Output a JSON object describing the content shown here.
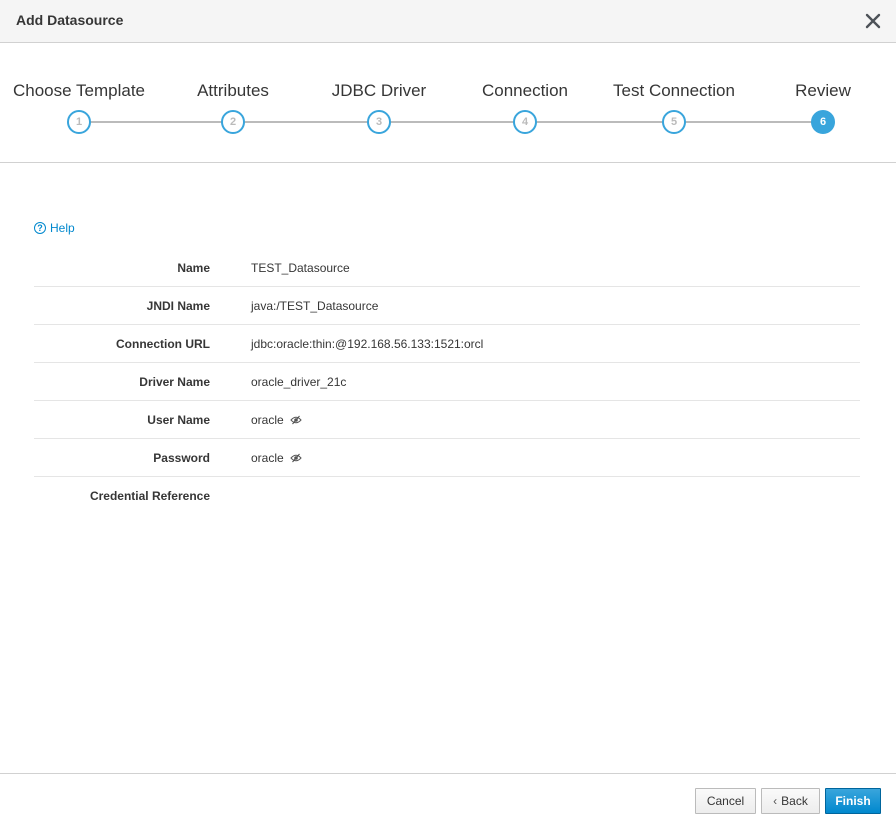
{
  "modal": {
    "title": "Add Datasource"
  },
  "wizard": {
    "steps": [
      {
        "label": "Choose Template",
        "number": "1"
      },
      {
        "label": "Attributes",
        "number": "2"
      },
      {
        "label": "JDBC Driver",
        "number": "3"
      },
      {
        "label": "Connection",
        "number": "4"
      },
      {
        "label": "Test Connection",
        "number": "5"
      },
      {
        "label": "Review",
        "number": "6"
      }
    ],
    "active_step": 6
  },
  "help": {
    "label": "Help",
    "icon": "question-circle-icon"
  },
  "review": {
    "rows": [
      {
        "label": "Name",
        "value": "TEST_Datasource"
      },
      {
        "label": "JNDI Name",
        "value": "java:/TEST_Datasource"
      },
      {
        "label": "Connection URL",
        "value": "jdbc:oracle:thin:@192.168.56.133:1521:orcl"
      },
      {
        "label": "Driver Name",
        "value": "oracle_driver_21c"
      },
      {
        "label": "User Name",
        "value": "oracle"
      },
      {
        "label": "Password",
        "value": "oracle"
      },
      {
        "label": "Credential Reference",
        "value": ""
      }
    ]
  },
  "footer": {
    "cancel_label": "Cancel",
    "back_label": "Back",
    "finish_label": "Finish"
  },
  "colors": {
    "accent": "#39a5dc",
    "primary_button": "#0088ce",
    "header_bg": "#f5f5f5"
  }
}
